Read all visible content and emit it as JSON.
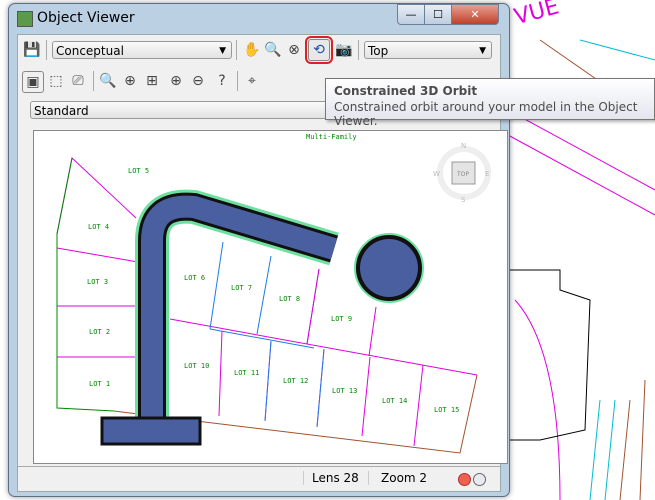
{
  "window": {
    "title": "Object Viewer",
    "minimize": "—",
    "maximize": "☐",
    "close": "✕"
  },
  "toolbar": {
    "visual_style": "Conceptual",
    "view": "Top",
    "highlighted_tool": "constrained-3d-orbit"
  },
  "named_view": "Standard",
  "tooltip": {
    "title": "Constrained 3D Orbit",
    "description": "Constrained orbit around your model in the Object Viewer."
  },
  "viewcube": {
    "top": "TOP",
    "n": "N",
    "s": "S",
    "e": "E",
    "w": "W"
  },
  "drawing": {
    "top_label": "Multi-Family",
    "lots": [
      "LOT 5",
      "LOT 4",
      "LOT 3",
      "LOT 2",
      "LOT 1",
      "LOT 6",
      "LOT 7",
      "LOT 8",
      "LOT 9",
      "LOT 10",
      "LOT 11",
      "LOT 12",
      "LOT 13",
      "LOT 14",
      "LOT 15"
    ]
  },
  "status": {
    "lens": "Lens 28",
    "zoom": "Zoom 2"
  },
  "background_text": "VUE",
  "colors": {
    "road": "#4a5fa0",
    "highlight": "#e02020",
    "lot_line": "#ff00ff",
    "lot_line2": "#1e7be8"
  }
}
